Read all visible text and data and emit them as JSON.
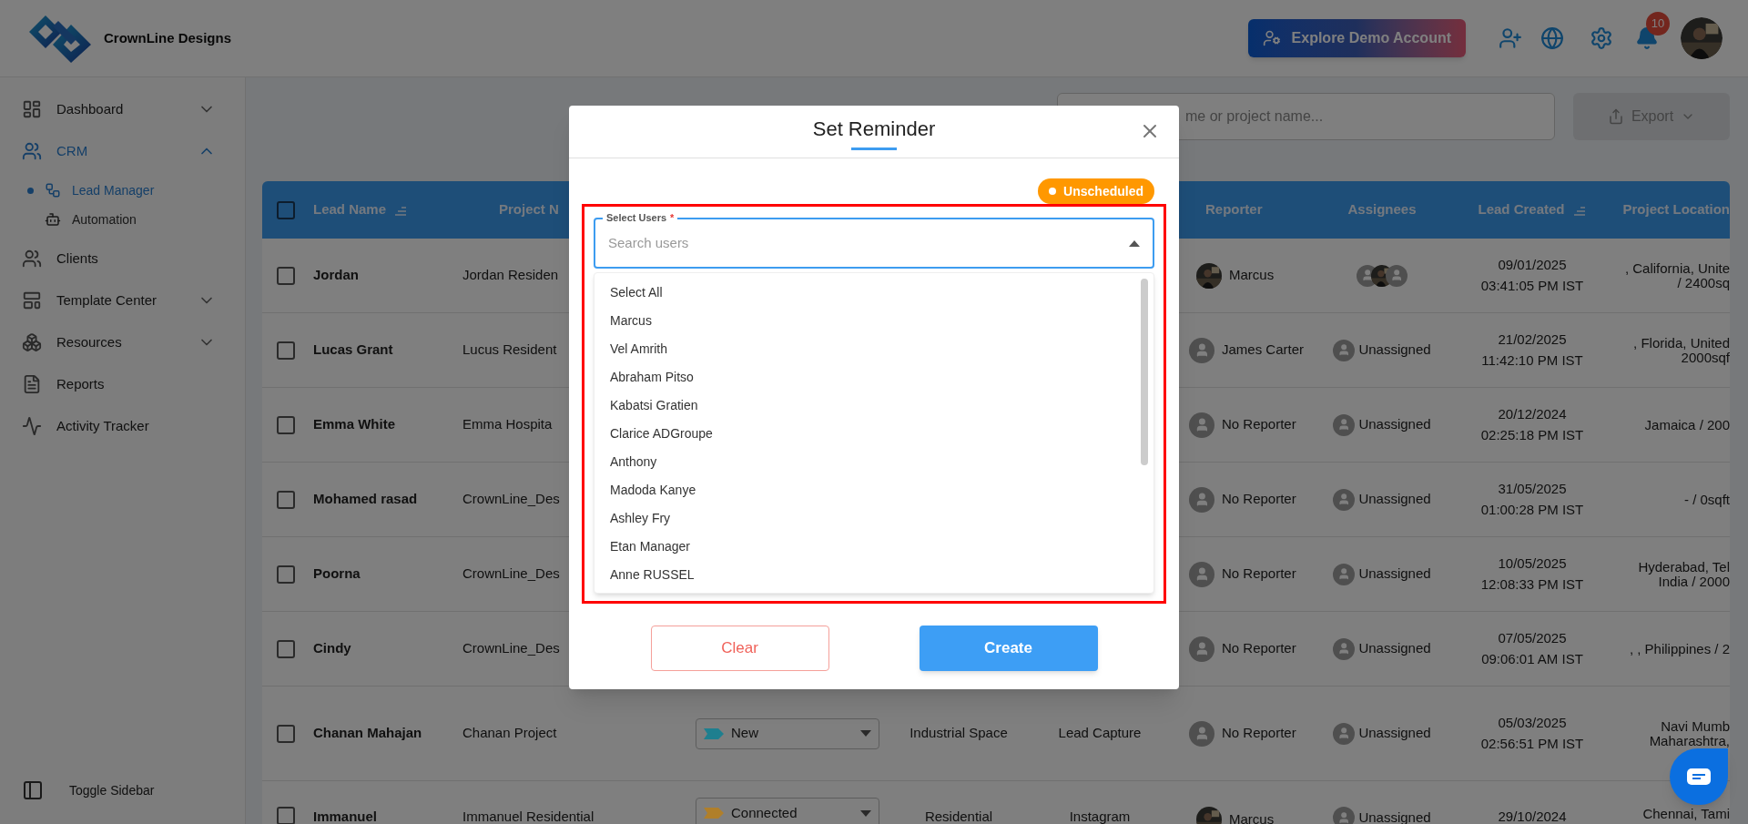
{
  "header": {
    "brand": "CrownLine Designs",
    "demo_button": "Explore Demo Account",
    "notifications": "10"
  },
  "sidebar": {
    "items": [
      {
        "label": "Dashboard",
        "kind": "group",
        "expanded": false,
        "selected": false
      },
      {
        "label": "CRM",
        "kind": "group",
        "expanded": true,
        "selected": true,
        "children": [
          {
            "label": "Lead Manager",
            "selected": true
          },
          {
            "label": "Automation",
            "selected": false
          }
        ]
      },
      {
        "label": "Clients",
        "kind": "link",
        "selected": false
      },
      {
        "label": "Template Center",
        "kind": "group",
        "expanded": false,
        "selected": false
      },
      {
        "label": "Resources",
        "kind": "group",
        "expanded": false,
        "selected": false
      },
      {
        "label": "Reports",
        "kind": "link",
        "selected": false
      },
      {
        "label": "Activity Tracker",
        "kind": "link",
        "selected": false
      }
    ],
    "toggle": "Toggle Sidebar"
  },
  "toolbar": {
    "search_placeholder": "me or project name...",
    "export": "Export"
  },
  "table": {
    "all_checked": false,
    "columns": [
      {
        "label": "Lead Name",
        "sortable": true
      },
      {
        "label": "Project N",
        "sortable": false
      },
      {
        "label": "Reporter",
        "sortable": false
      },
      {
        "label": "Assignees",
        "sortable": false
      },
      {
        "label": "Lead Created",
        "sortable": true
      },
      {
        "label": "Project Location",
        "sortable": false
      }
    ],
    "rows": [
      {
        "checked": false,
        "name": "Jordan",
        "project": "Jordan Residen",
        "reporter": {
          "name": "Marcus"
        },
        "assignees": {
          "kind": "group"
        },
        "created": [
          "09/01/2025",
          "03:41:05 PM IST"
        ],
        "location": [
          ", California, Unite",
          "/ 2400sq"
        ]
      },
      {
        "checked": false,
        "name": "Lucas Grant",
        "project": "Lucus Resident",
        "reporter": {
          "kind": "placeholder",
          "name": "James Carter"
        },
        "assignees": {
          "kind": "unassigned",
          "label": "Unassigned"
        },
        "created": [
          "21/02/2025",
          "11:42:10 PM IST"
        ],
        "location": [
          ", Florida, United",
          "2000sqf"
        ]
      },
      {
        "checked": false,
        "name": "Emma White",
        "project": "Emma Hospita",
        "reporter": {
          "kind": "placeholder",
          "name": "No Reporter"
        },
        "assignees": {
          "kind": "unassigned",
          "label": "Unassigned"
        },
        "created": [
          "20/12/2024",
          "02:25:18 PM IST"
        ],
        "location": [
          "Jamaica / 200"
        ]
      },
      {
        "checked": false,
        "name": "Mohamed rasad",
        "project": "CrownLine_Des",
        "reporter": {
          "kind": "placeholder",
          "name": "No Reporter"
        },
        "assignees": {
          "kind": "unassigned",
          "label": "Unassigned"
        },
        "created": [
          "31/05/2025",
          "01:00:28 PM IST"
        ],
        "location": [
          "- / 0sqft"
        ]
      },
      {
        "checked": false,
        "name": "Poorna",
        "project": "CrownLine_Des",
        "reporter": {
          "kind": "placeholder",
          "name": "No Reporter"
        },
        "assignees": {
          "kind": "unassigned",
          "label": "Unassigned"
        },
        "created": [
          "10/05/2025",
          "12:08:33 PM IST"
        ],
        "location": [
          "Hyderabad, Tel",
          "India / 2000"
        ]
      },
      {
        "checked": false,
        "name": "Cindy",
        "project": "CrownLine_Des",
        "reporter": {
          "kind": "placeholder",
          "name": "No Reporter"
        },
        "assignees": {
          "kind": "unassigned",
          "label": "Unassigned"
        },
        "created": [
          "07/05/2025",
          "09:06:01 AM IST"
        ],
        "location": [
          ", , Philippines / 2"
        ]
      },
      {
        "checked": false,
        "name": "Chanan Mahajan",
        "project": "Chanan Project",
        "status": {
          "label": "New",
          "color": "#1e7f8f"
        },
        "project_type": "Industrial Space",
        "source": "Lead Capture",
        "reporter": {
          "kind": "placeholder",
          "name": "No Reporter"
        },
        "assignees": {
          "kind": "unassigned",
          "label": "Unassigned"
        },
        "created": [
          "05/03/2025",
          "02:56:51 PM IST"
        ],
        "location": [
          "Navi Mumb",
          "Maharashtra,"
        ]
      },
      {
        "checked": false,
        "name": "Immanuel",
        "project": "Immanuel Residential",
        "status": {
          "label": "Connected",
          "color": "#b07f2a"
        },
        "project_type": "Residential",
        "source": "Instagram",
        "reporter": {
          "name": "Marcus"
        },
        "assignees": {
          "kind": "unassigned",
          "label": "Unassigned"
        },
        "created": [
          "29/10/2024"
        ],
        "location": [
          "Chennai, Tami"
        ]
      }
    ]
  },
  "modal": {
    "title": "Set Reminder",
    "badge": "Unscheduled",
    "field": {
      "label": "Select Users",
      "required_mark": "*",
      "placeholder": "Search users",
      "open": true
    },
    "options": [
      "Select All",
      "Marcus",
      "Vel Amrith",
      "Abraham Pitso",
      "Kabatsi Gratien",
      "Clarice ADGroupe",
      "Anthony",
      "Madoda Kanye",
      "Ashley Fry",
      "Etan Manager",
      "Anne RUSSEL"
    ],
    "buttons": [
      {
        "kind": "secondary",
        "label": "Clear"
      },
      {
        "kind": "primary",
        "label": "Create"
      }
    ]
  }
}
